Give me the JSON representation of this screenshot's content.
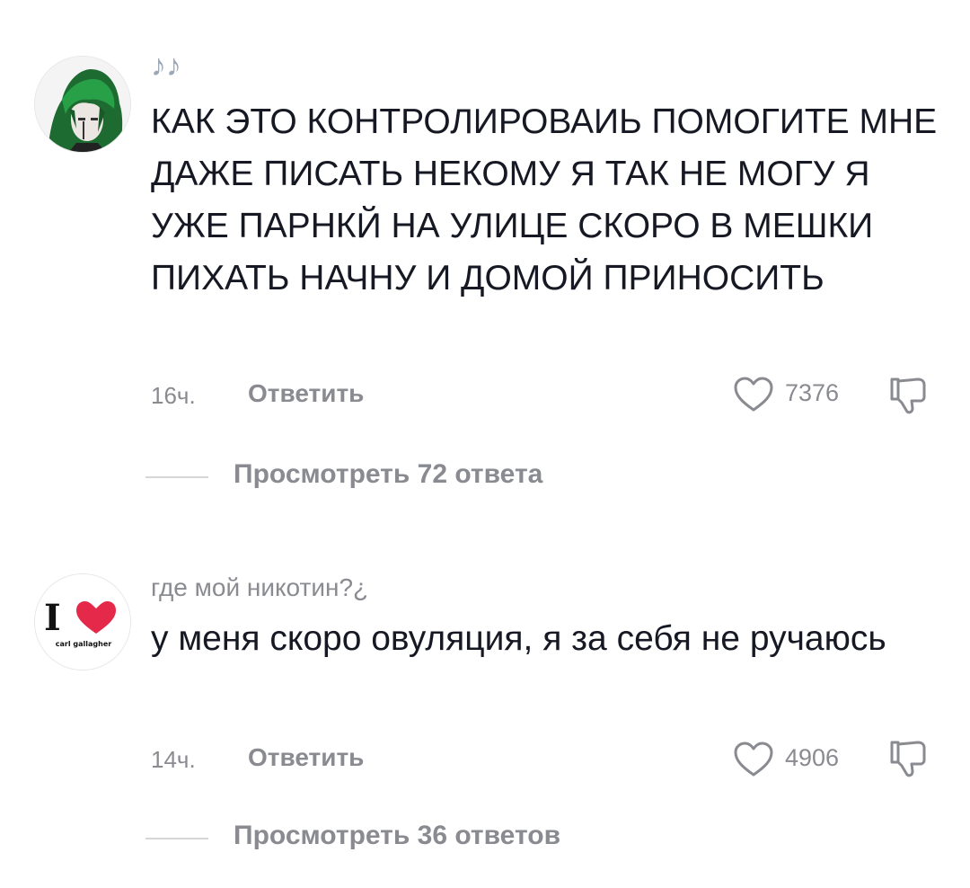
{
  "comments": [
    {
      "username": "♪♪",
      "text": "КАК ЭТО КОНТРОЛИРОВАИЬ ПОМОГИТЕ МНЕ ДАЖЕ ПИСАТЬ НЕКОМУ Я ТАК НЕ МОГУ Я УЖЕ ПАРНКЙ НА УЛИЦЕ СКОРО В МЕШКИ ПИХАТЬ НАЧНУ И ДОМОЙ ПРИНОСИТЬ",
      "time": "16ч.",
      "reply_label": "Ответить",
      "likes": "7376",
      "view_replies": "Просмотреть 72 ответа",
      "avatar_icon": "green-haired-character-avatar"
    },
    {
      "username": "где мой никотин?¿",
      "text": "у меня скоро овуляция, я за себя не ручаюсь",
      "time": "14ч.",
      "reply_label": "Ответить",
      "likes": "4906",
      "view_replies": "Просмотреть 36 ответов",
      "avatar_icon": "i-love-carl-gallagher-avatar",
      "avatar_text": {
        "letter": "I",
        "caption": "carl gallagher"
      }
    }
  ],
  "colors": {
    "text": "#161823",
    "secondary": "#8a8b91",
    "heart": "#e5294a",
    "avatar_green": "#1f8a3a"
  }
}
